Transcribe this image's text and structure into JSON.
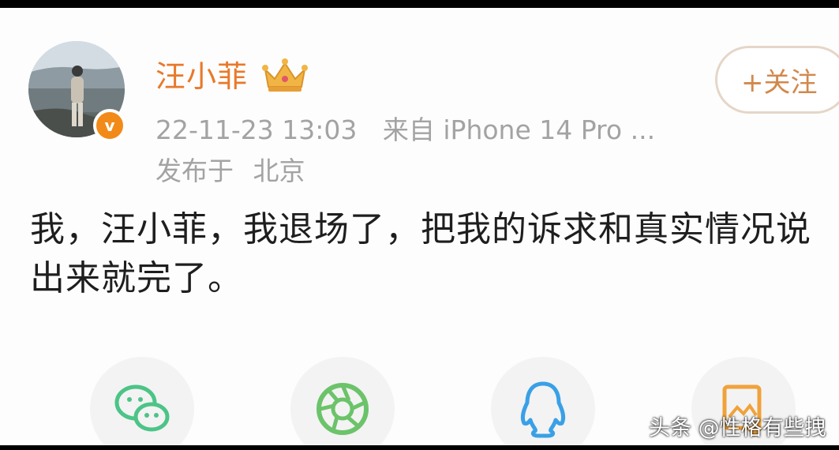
{
  "post": {
    "username": "汪小菲",
    "badge_icon": "crown-icon",
    "verified_icon": "v-verified-icon",
    "verified_glyph": "v",
    "timestamp": "22-11-23 13:03",
    "source": "来自 iPhone 14 Pro ...",
    "location_prefix": "发布于",
    "location": "北京",
    "follow_label": "+关注",
    "text_line1": "我，汪小菲，我退场了，把我的诉求和真实情况说",
    "text_line2": "出来就完了。"
  },
  "share": {
    "items": [
      {
        "icon": "wechat-icon"
      },
      {
        "icon": "moments-icon"
      },
      {
        "icon": "qq-icon"
      },
      {
        "icon": "save-image-icon"
      }
    ]
  },
  "watermark": {
    "text": "头条 @性格有些拽"
  },
  "colors": {
    "username": "#e8792a",
    "meta": "#a3a3a3",
    "follow": "#d2884c",
    "wechat": "#4cc487",
    "moments": "#6cc36a",
    "qq": "#3aa0e6",
    "save": "#f0a23a"
  }
}
